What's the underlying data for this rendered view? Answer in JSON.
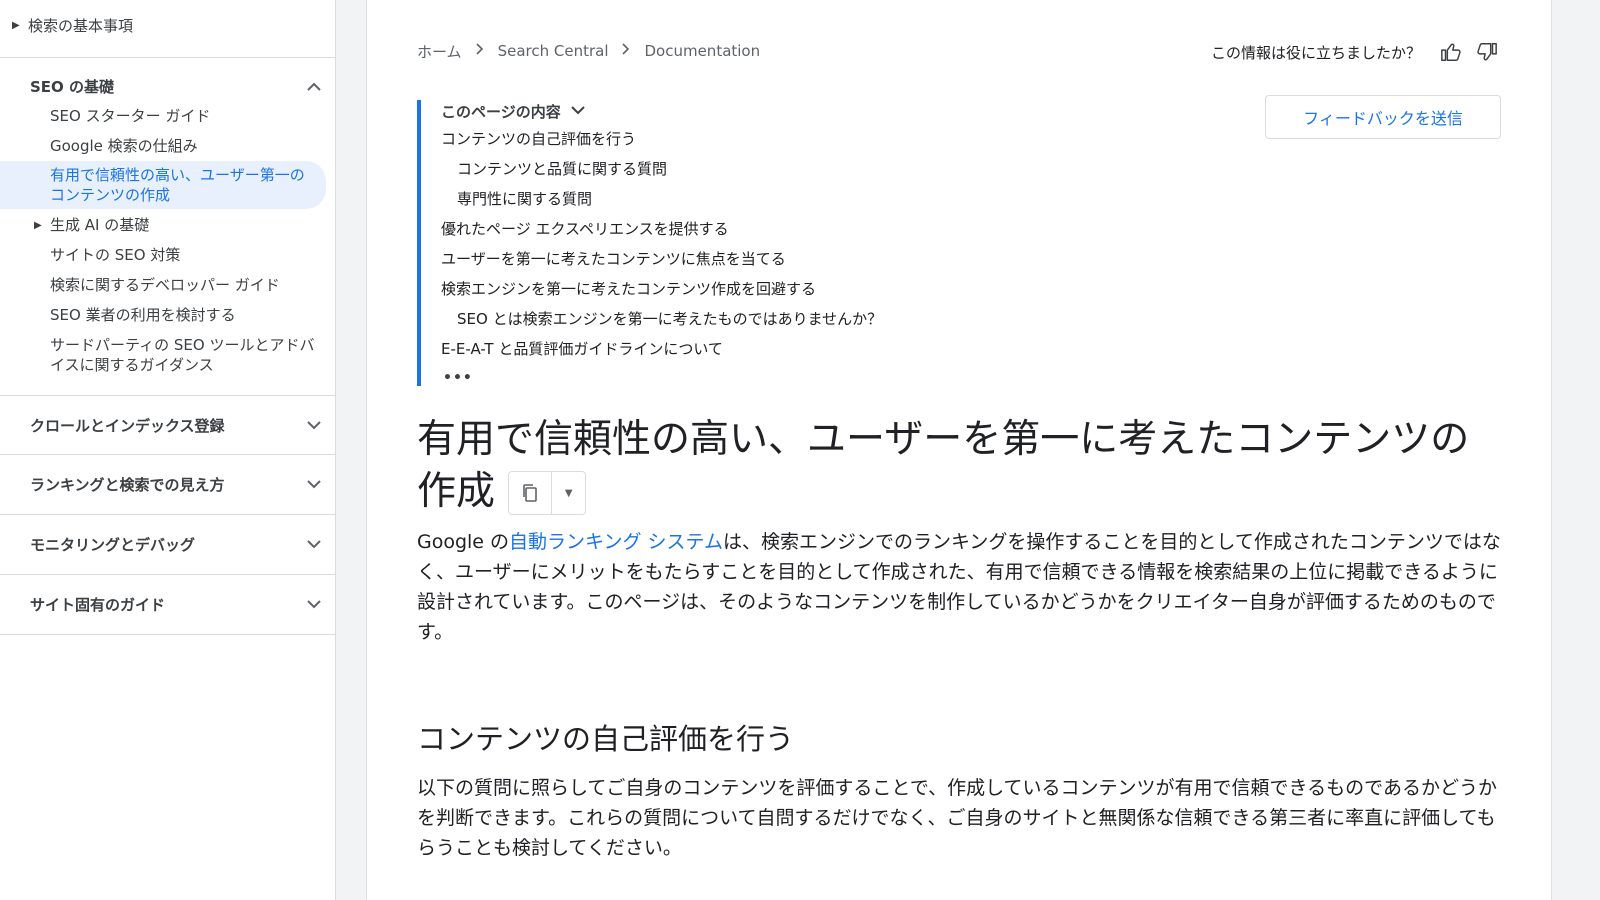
{
  "sidebar": {
    "top_item": "検索の基本事項",
    "section_seo": "SEO の基礎",
    "items": [
      "SEO スターター ガイド",
      "Google 検索の仕組み",
      "有用で信頼性の高い、ユーザー第一のコンテンツの作成",
      "生成 AI の基礎",
      "サイトの SEO 対策",
      "検索に関するデベロッパー ガイド",
      "SEO 業者の利用を検討する",
      "サードパーティの SEO ツールとアドバイスに関するガイダンス"
    ],
    "sections": [
      "クロールとインデックス登録",
      "ランキングと検索での見え方",
      "モニタリングとデバッグ",
      "サイト固有のガイド"
    ]
  },
  "breadcrumb": [
    "ホーム",
    "Search Central",
    "Documentation"
  ],
  "helpful_text": "この情報は役に立ちましたか？",
  "feedback_label": "フィードバックを送信",
  "toc": {
    "title": "このページの内容",
    "items": [
      "コンテンツの自己評価を行う",
      "コンテンツと品質に関する質問",
      "専門性に関する質問",
      "優れたページ エクスペリエンスを提供する",
      "ユーザーを第一に考えたコンテンツに焦点を当てる",
      "検索エンジンを第一に考えたコンテンツ作成を回避する",
      "SEO とは検索エンジンを第一に考えたものではありませんか？",
      "E-E-A-T と品質評価ガイドラインについて"
    ],
    "more": "•••"
  },
  "page_title": "有用で信頼性の高い、ユーザーを第一に考えたコンテンツの作成",
  "intro": {
    "pre": "Google の",
    "link": "自動ランキング システム",
    "post": "は、検索エンジンでのランキングを操作することを目的として作成されたコンテンツではなく、ユーザーにメリットをもたらすことを目的として作成された、有用で信頼できる情報を検索結果の上位に掲載できるように設計されています。このページは、そのようなコンテンツを制作しているかどうかをクリエイター自身が評価するためのものです。"
  },
  "section_heading": "コンテンツの自己評価を行う",
  "section_text": "以下の質問に照らしてご自身のコンテンツを評価することで、作成しているコンテンツが有用で信頼できるものであるかどうかを判断できます。これらの質問について自問するだけでなく、ご自身のサイトと無関係な信頼できる第三者に率直に評価してもらうことも検討してください。",
  "colors": {
    "accent": "#1a73e8",
    "active_bg": "#e8f0fe"
  }
}
